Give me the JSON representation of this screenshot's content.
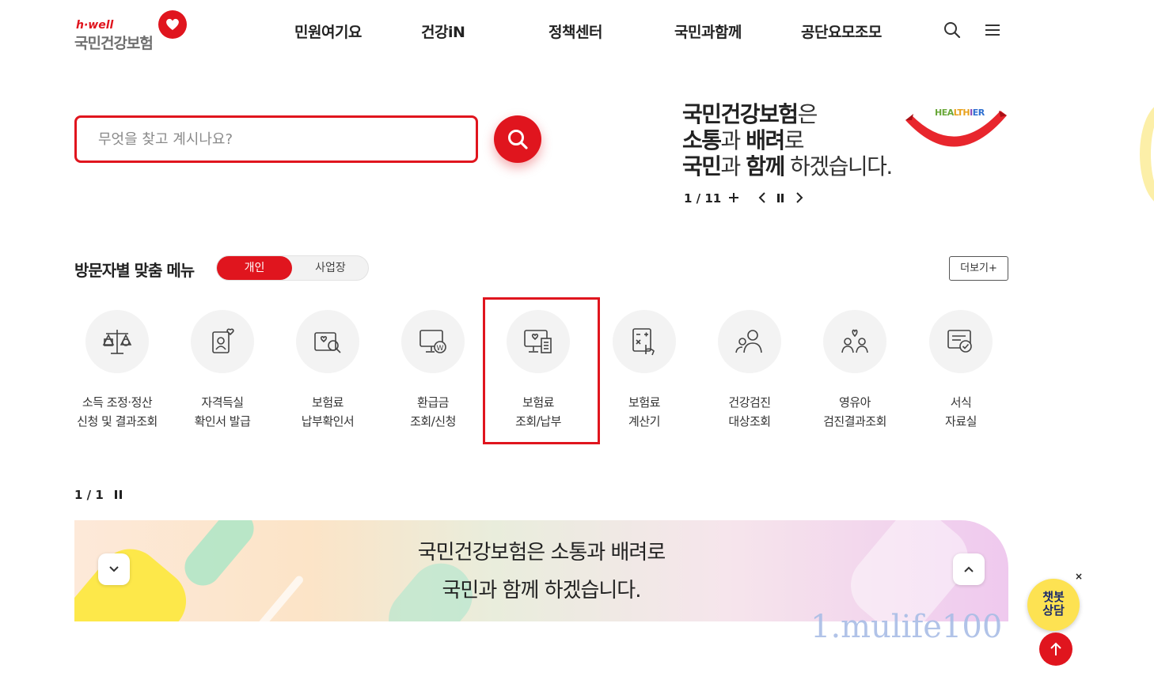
{
  "header": {
    "logo_small": "h·well",
    "logo_main": "국민건강보험",
    "nav": [
      "민원여기요",
      "건강iN",
      "정책센터",
      "국민과함께",
      "공단요모조모"
    ],
    "icons": [
      "search-icon",
      "hamburger-menu-icon"
    ]
  },
  "search": {
    "placeholder": "무엇을 찾고 계시나요?",
    "button_icon": "search-icon"
  },
  "slogan": {
    "line1_bold": "국민건강보험",
    "line1_light": "은",
    "line2_bold1": "소통",
    "line2_light1": "과 ",
    "line2_bold2": "배려",
    "line2_light2": "로",
    "line3_bold1": "국민",
    "line3_light1": "과 ",
    "line3_bold2": "함께",
    "line3_light2": " 하겠습니다.",
    "ribbon_label": [
      "HEA",
      "LTH",
      "I",
      "ER"
    ],
    "pager": "1 / 11"
  },
  "menu": {
    "title": "방문자별 맞춤 메뉴",
    "toggle_on": "개인",
    "toggle_off": "사업장",
    "more": "더보기+",
    "items": [
      {
        "line1": "소득 조정·정산",
        "line2": "신청 및 결과조회",
        "icon": "scale-icon"
      },
      {
        "line1": "자격득실",
        "line2": "확인서 발급",
        "icon": "id-card-icon"
      },
      {
        "line1": "보험료",
        "line2": "납부확인서",
        "icon": "document-search-icon"
      },
      {
        "line1": "환급금",
        "line2": "조회/신청",
        "icon": "monitor-won-icon"
      },
      {
        "line1": "보험료",
        "line2": "조회/납부",
        "icon": "monitor-receipt-icon"
      },
      {
        "line1": "보험료",
        "line2": "계산기",
        "icon": "calculator-icon"
      },
      {
        "line1": "건강검진",
        "line2": "대상조회",
        "icon": "people-search-icon"
      },
      {
        "line1": "영유아",
        "line2": "검진결과조회",
        "icon": "family-heart-icon"
      },
      {
        "line1": "서식",
        "line2": "자료실",
        "icon": "form-check-icon"
      }
    ],
    "pager": "1 / 1"
  },
  "banner": {
    "line1": "국민건강보험은 소통과 배려로",
    "line2": "국민과 함께 하겠습니다."
  },
  "watermark": "1.mulife100",
  "chatbot": {
    "line1": "챗봇",
    "line2": "상담",
    "close": "×"
  },
  "colors": {
    "accent": "#e0151e",
    "chatbot": "#fde252",
    "watermark": "#a9bde6"
  }
}
